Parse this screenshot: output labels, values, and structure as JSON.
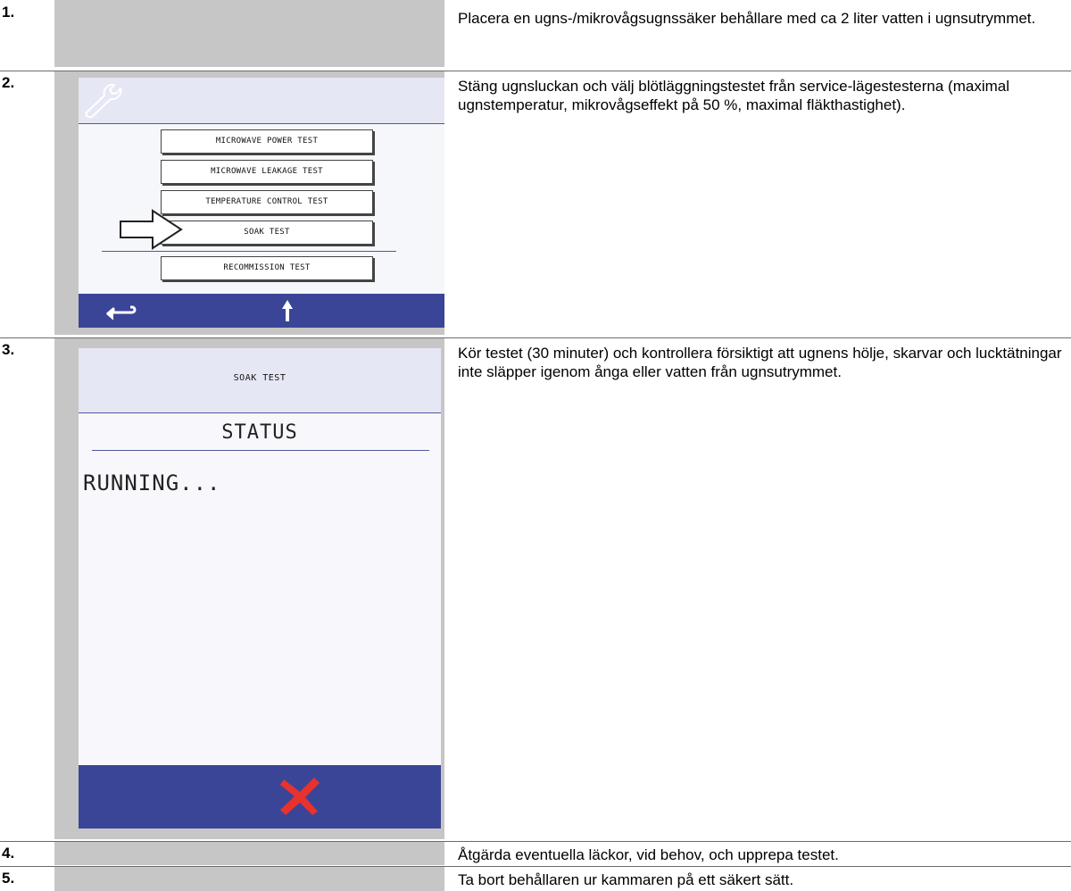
{
  "steps": [
    {
      "number": "1.",
      "text": "Placera en ugns-/mikrovågsugnssäker behållare med ca 2 liter vatten i ugnsutrymmet."
    },
    {
      "number": "2.",
      "text": "Stäng ugnsluckan och välj blötläggningstestet från service-lägestesterna (maximal ugnstemperatur, mikrovågseffekt på 50 %, maximal fläkthastighet)."
    },
    {
      "number": "3.",
      "text": "Kör testet (30 minuter) och kontrollera försiktigt att ugnens hölje, skarvar och lucktätningar inte släpper igenom ånga eller vatten från ugnsutrymmet."
    },
    {
      "number": "4.",
      "text": "Åtgärda eventuella läckor, vid behov, och upprepa testet."
    },
    {
      "number": "5.",
      "text": "Ta bort behållaren ur kammaren på ett säkert sätt."
    }
  ],
  "service_menu": {
    "items": [
      "MICROWAVE POWER TEST",
      "MICROWAVE LEAKAGE TEST",
      "TEMPERATURE CONTROL TEST",
      "SOAK TEST",
      "RECOMMISSION TEST"
    ],
    "selected": "SOAK TEST",
    "icons": {
      "header": "wrench-icon",
      "back": "back-arrow-icon",
      "up": "up-arrow-icon",
      "pointer": "pointer-arrow-icon"
    },
    "colors": {
      "header": "#e6e7f4",
      "footer": "#3a4597",
      "screen": "#f6f7fb"
    }
  },
  "soak_screen": {
    "title": "SOAK TEST",
    "status_heading": "STATUS",
    "status_value": "RUNNING...",
    "icons": {
      "cancel": "cancel-x-icon"
    },
    "colors": {
      "cancel": "#e8322d",
      "footer": "#3a4597"
    }
  }
}
